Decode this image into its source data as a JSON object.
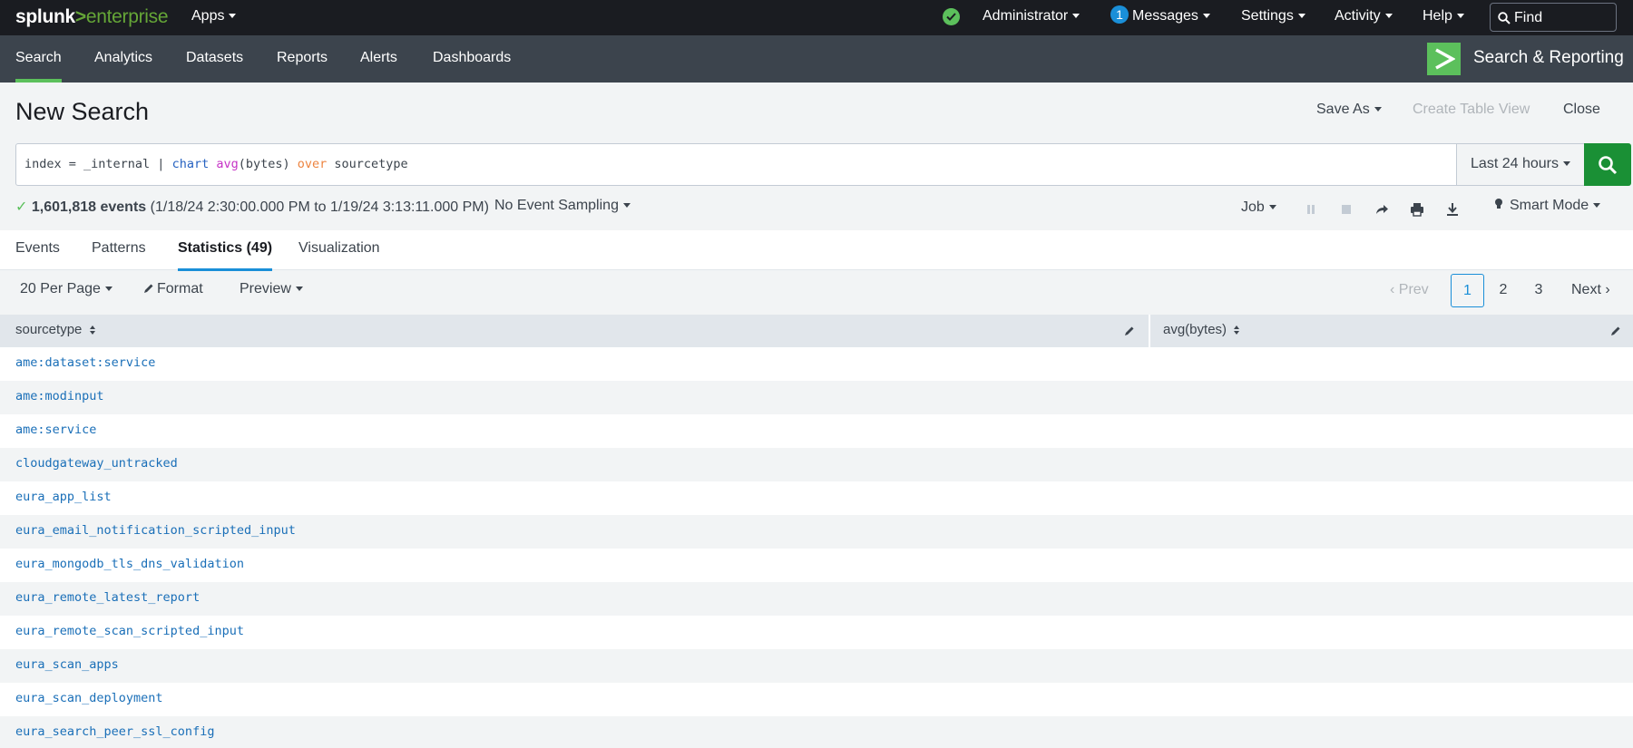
{
  "topbar": {
    "logo": {
      "splunk": "splunk",
      "gt": ">",
      "enterprise": "enterprise"
    },
    "apps_label": "Apps",
    "status_icon": "check-circle-icon",
    "admin_label": "Administrator",
    "messages_count": "1",
    "messages_label": "Messages",
    "settings_label": "Settings",
    "activity_label": "Activity",
    "help_label": "Help",
    "find_placeholder": "Find"
  },
  "appbar": {
    "nav": [
      {
        "label": "Search",
        "active": true
      },
      {
        "label": "Analytics"
      },
      {
        "label": "Datasets"
      },
      {
        "label": "Reports"
      },
      {
        "label": "Alerts"
      },
      {
        "label": "Dashboards"
      }
    ],
    "app_title": "Search & Reporting"
  },
  "header": {
    "title": "New Search",
    "save_as": "Save As",
    "create_table_view": "Create Table View",
    "close": "Close"
  },
  "search": {
    "query_parts": {
      "p1": "index = _internal | ",
      "p2": "chart",
      "p3": " ",
      "p4": "avg",
      "p5": "(bytes) ",
      "p6": "over",
      "p7": " sourcetype"
    },
    "time_range": "Last 24 hours"
  },
  "status": {
    "check": "✓",
    "event_count": "1,601,818 events",
    "time_span": "(1/18/24 2:30:00.000 PM to 1/19/24 3:13:11.000 PM)",
    "sampling": "No Event Sampling",
    "job": "Job",
    "mode": "Smart Mode"
  },
  "tabs": [
    {
      "label": "Events"
    },
    {
      "label": "Patterns"
    },
    {
      "label": "Statistics (49)",
      "active": true
    },
    {
      "label": "Visualization"
    }
  ],
  "results": {
    "per_page": "20 Per Page",
    "format": "Format",
    "preview": "Preview",
    "prev": "Prev",
    "pages": [
      "1",
      "2",
      "3"
    ],
    "next": "Next"
  },
  "table": {
    "columns": [
      "sourcetype",
      "avg(bytes)"
    ],
    "rows": [
      {
        "sourcetype": "ame:dataset:service",
        "avg_bytes": ""
      },
      {
        "sourcetype": "ame:modinput",
        "avg_bytes": ""
      },
      {
        "sourcetype": "ame:service",
        "avg_bytes": ""
      },
      {
        "sourcetype": "cloudgateway_untracked",
        "avg_bytes": ""
      },
      {
        "sourcetype": "eura_app_list",
        "avg_bytes": ""
      },
      {
        "sourcetype": "eura_email_notification_scripted_input",
        "avg_bytes": ""
      },
      {
        "sourcetype": "eura_mongodb_tls_dns_validation",
        "avg_bytes": ""
      },
      {
        "sourcetype": "eura_remote_latest_report",
        "avg_bytes": ""
      },
      {
        "sourcetype": "eura_remote_scan_scripted_input",
        "avg_bytes": ""
      },
      {
        "sourcetype": "eura_scan_apps",
        "avg_bytes": ""
      },
      {
        "sourcetype": "eura_scan_deployment",
        "avg_bytes": ""
      },
      {
        "sourcetype": "eura_search_peer_ssl_config",
        "avg_bytes": ""
      }
    ]
  },
  "colors": {
    "brand_green": "#65a637",
    "search_button": "#1a9035",
    "link_blue": "#1a6fb8",
    "active_tab": "#1a8fd8"
  }
}
